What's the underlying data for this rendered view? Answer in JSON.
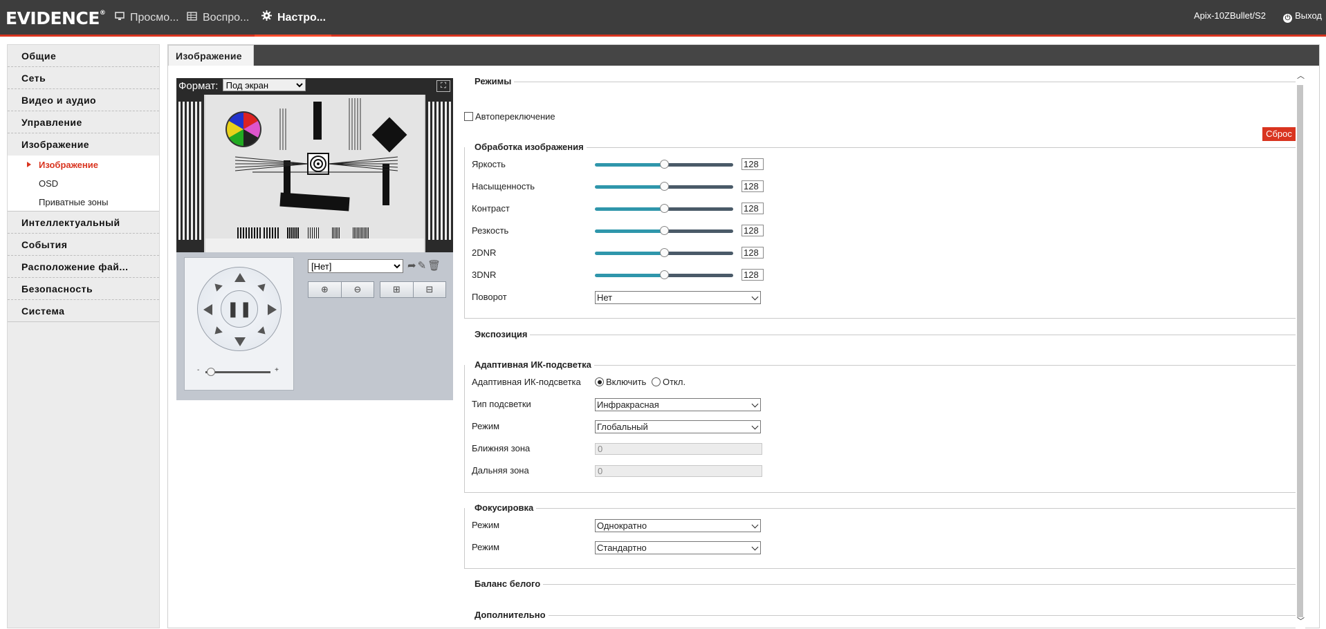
{
  "header": {
    "logo": "EVIDENCE",
    "logo_mark": "®",
    "tabs": [
      {
        "label": "Просмо..."
      },
      {
        "label": "Воспро..."
      },
      {
        "label": "Настро..."
      }
    ],
    "device": "Apix-10ZBullet/S2",
    "logout": "Выход"
  },
  "sidebar": {
    "items": [
      {
        "label": "Общие"
      },
      {
        "label": "Сеть"
      },
      {
        "label": "Видео и аудио"
      },
      {
        "label": "Управление"
      },
      {
        "label": "Изображение"
      },
      {
        "label": "Интеллектуальный"
      },
      {
        "label": "События"
      },
      {
        "label": "Расположение фай..."
      },
      {
        "label": "Безопасность"
      },
      {
        "label": "Система"
      }
    ],
    "sub_items": [
      {
        "label": "Изображение"
      },
      {
        "label": "OSD"
      },
      {
        "label": "Приватные зоны"
      }
    ]
  },
  "content": {
    "tab": "Изображение"
  },
  "preview": {
    "format_label": "Формат:",
    "format_value": "Под экран",
    "preset_value": "[Нет]",
    "zoom_min": "-",
    "zoom_max": "+"
  },
  "sections": {
    "modes": "Режимы",
    "auto_switch": "Автопереключение",
    "processing": "Обработка изображения",
    "reset": "Сброс",
    "exposure": "Экспозиция",
    "ir": "Адаптивная ИК-подсветка",
    "focus": "Фокусировка",
    "wb": "Баланс белого",
    "extra": "Дополнительно"
  },
  "image_processing": {
    "brightness": {
      "label": "Яркость",
      "value": "128",
      "level": 0.5
    },
    "saturation": {
      "label": "Насыщенность",
      "value": "128",
      "level": 0.5
    },
    "contrast": {
      "label": "Контраст",
      "value": "128",
      "level": 0.5
    },
    "sharpness": {
      "label": "Резкость",
      "value": "128",
      "level": 0.5
    },
    "dnr2": {
      "label": "2DNR",
      "value": "128",
      "level": 0.5
    },
    "dnr3": {
      "label": "3DNR",
      "value": "128",
      "level": 0.5
    },
    "rotation": {
      "label": "Поворот",
      "value": "Нет"
    }
  },
  "ir_settings": {
    "adaptive_label": "Адаптивная ИК-подсветка",
    "on_label": "Включить",
    "off_label": "Откл.",
    "type_label": "Тип подсветки",
    "type_value": "Инфракрасная",
    "mode_label": "Режим",
    "mode_value": "Глобальный",
    "near_label": "Ближняя зона",
    "near_value": "0",
    "far_label": "Дальняя зона",
    "far_value": "0"
  },
  "focus_settings": {
    "mode1_label": "Режим",
    "mode1_value": "Однократно",
    "mode2_label": "Режим",
    "mode2_value": "Стандартно"
  },
  "colors": {
    "accent": "#d9341f",
    "topbar": "#3d3d3d",
    "slider_fill": "#2f96ab"
  }
}
